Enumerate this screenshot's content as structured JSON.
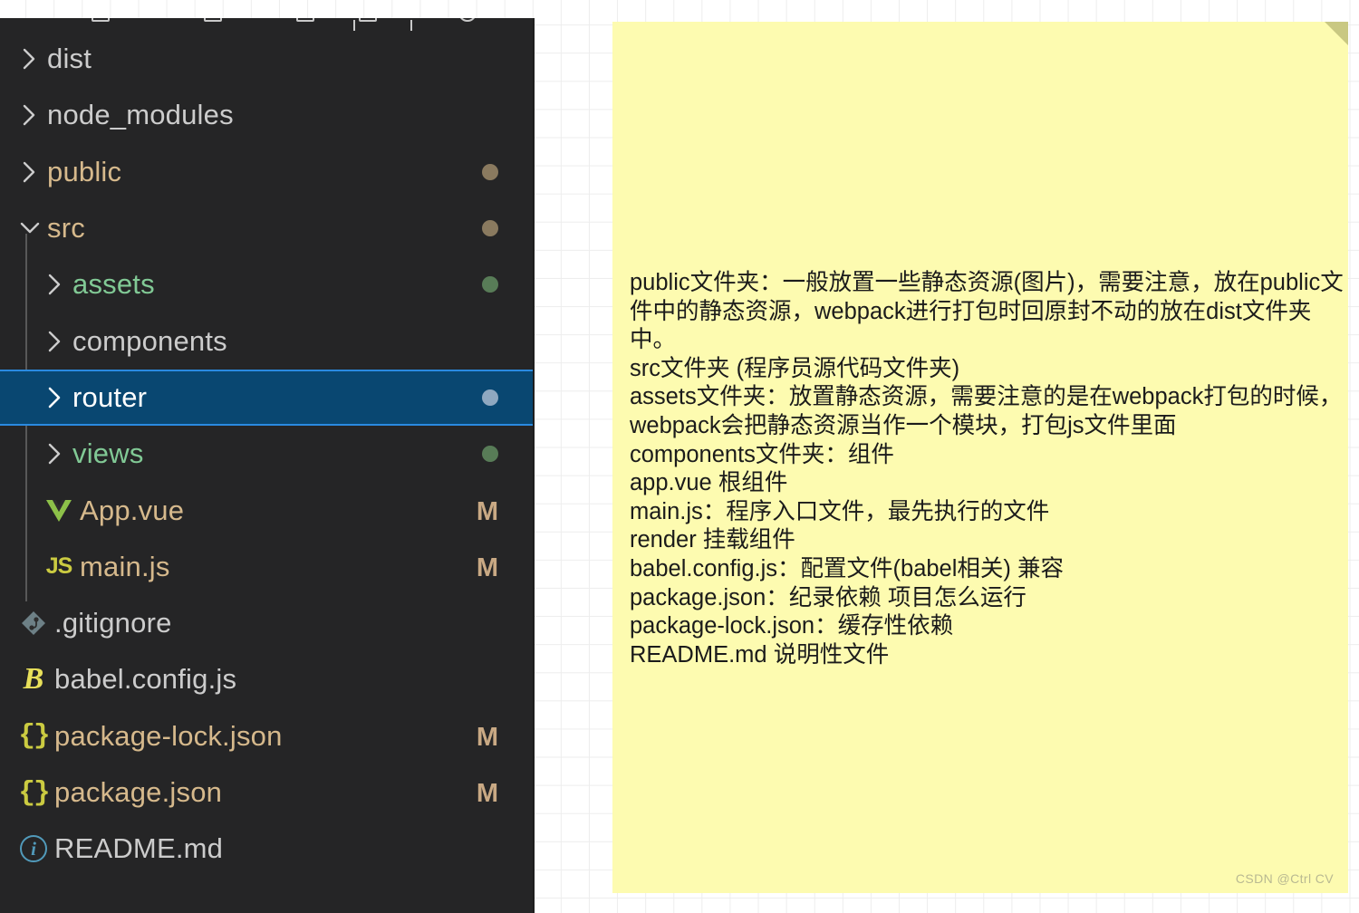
{
  "explorer": {
    "toolbar": {
      "icons": [
        "new-file-icon",
        "new-folder-icon",
        "refresh-icon",
        "collapse-all-icon"
      ]
    },
    "indicator_colors": {
      "modified_folder_dot": "#8a7a5f",
      "untracked_folder_dot": "#587c57",
      "selected_folder_dot": "#8fa8c0",
      "modified_letter": "#c9a984"
    },
    "selection_color": "#094771",
    "selection_border": "#2a8ae0",
    "rows": [
      {
        "label": "dist",
        "type": "folder",
        "expanded": false,
        "indent": 0,
        "color": "white",
        "badge": "",
        "icon": "chevron-right-icon"
      },
      {
        "label": "node_modules",
        "type": "folder",
        "expanded": false,
        "indent": 0,
        "color": "white",
        "badge": "",
        "icon": "chevron-right-icon"
      },
      {
        "label": "public",
        "type": "folder",
        "expanded": false,
        "indent": 0,
        "color": "tan",
        "badge": "dot-tan",
        "icon": "chevron-right-icon"
      },
      {
        "label": "src",
        "type": "folder",
        "expanded": true,
        "indent": 0,
        "color": "tan",
        "badge": "dot-tan",
        "icon": "chevron-down-icon"
      },
      {
        "label": "assets",
        "type": "folder",
        "expanded": false,
        "indent": 1,
        "color": "green",
        "badge": "dot-green",
        "icon": "chevron-right-icon"
      },
      {
        "label": "components",
        "type": "folder",
        "expanded": false,
        "indent": 1,
        "color": "white",
        "badge": "",
        "icon": "chevron-right-icon"
      },
      {
        "label": "router",
        "type": "folder",
        "expanded": false,
        "indent": 1,
        "color": "white",
        "badge": "dot-blue",
        "icon": "chevron-right-icon",
        "selected": true
      },
      {
        "label": "views",
        "type": "folder",
        "expanded": false,
        "indent": 1,
        "color": "green",
        "badge": "dot-green",
        "icon": "chevron-right-icon"
      },
      {
        "label": "App.vue",
        "type": "file",
        "indent": 1,
        "color": "tan",
        "badge": "M",
        "icon": "vue-file-icon"
      },
      {
        "label": "main.js",
        "type": "file",
        "indent": 1,
        "color": "tan",
        "badge": "M",
        "icon": "js-file-icon"
      },
      {
        "label": ".gitignore",
        "type": "file",
        "indent": 0,
        "color": "white",
        "badge": "",
        "icon": "git-file-icon"
      },
      {
        "label": "babel.config.js",
        "type": "file",
        "indent": 0,
        "color": "white",
        "badge": "",
        "icon": "babel-file-icon"
      },
      {
        "label": "package-lock.json",
        "type": "file",
        "indent": 0,
        "color": "tan",
        "badge": "M",
        "icon": "json-file-icon"
      },
      {
        "label": "package.json",
        "type": "file",
        "indent": 0,
        "color": "tan",
        "badge": "M",
        "icon": "json-file-icon"
      },
      {
        "label": "README.md",
        "type": "file",
        "indent": 0,
        "color": "white",
        "badge": "",
        "icon": "info-file-icon"
      }
    ]
  },
  "note": {
    "background_color": "#fdfbb0",
    "fold_color": "#c9c882",
    "lines": [
      "public文件夹：一般放置一些静态资源(图片)，需要注意，放在public文件中的静态资源，webpack进行打包时回原封不动的放在dist文件夹中。",
      "src文件夹 (程序员源代码文件夹)",
      "assets文件夹：放置静态资源，需要注意的是在webpack打包的时候，webpack会把静态资源当作一个模块，打包js文件里面",
      "components文件夹：组件",
      "app.vue 根组件",
      "main.js：程序入口文件，最先执行的文件",
      "render 挂载组件",
      "babel.config.js：配置文件(babel相关) 兼容",
      "package.json：纪录依赖 项目怎么运行",
      "package-lock.json：缓存性依赖",
      "README.md 说明性文件"
    ]
  },
  "watermark": {
    "text": "CSDN @Ctrl CV"
  }
}
